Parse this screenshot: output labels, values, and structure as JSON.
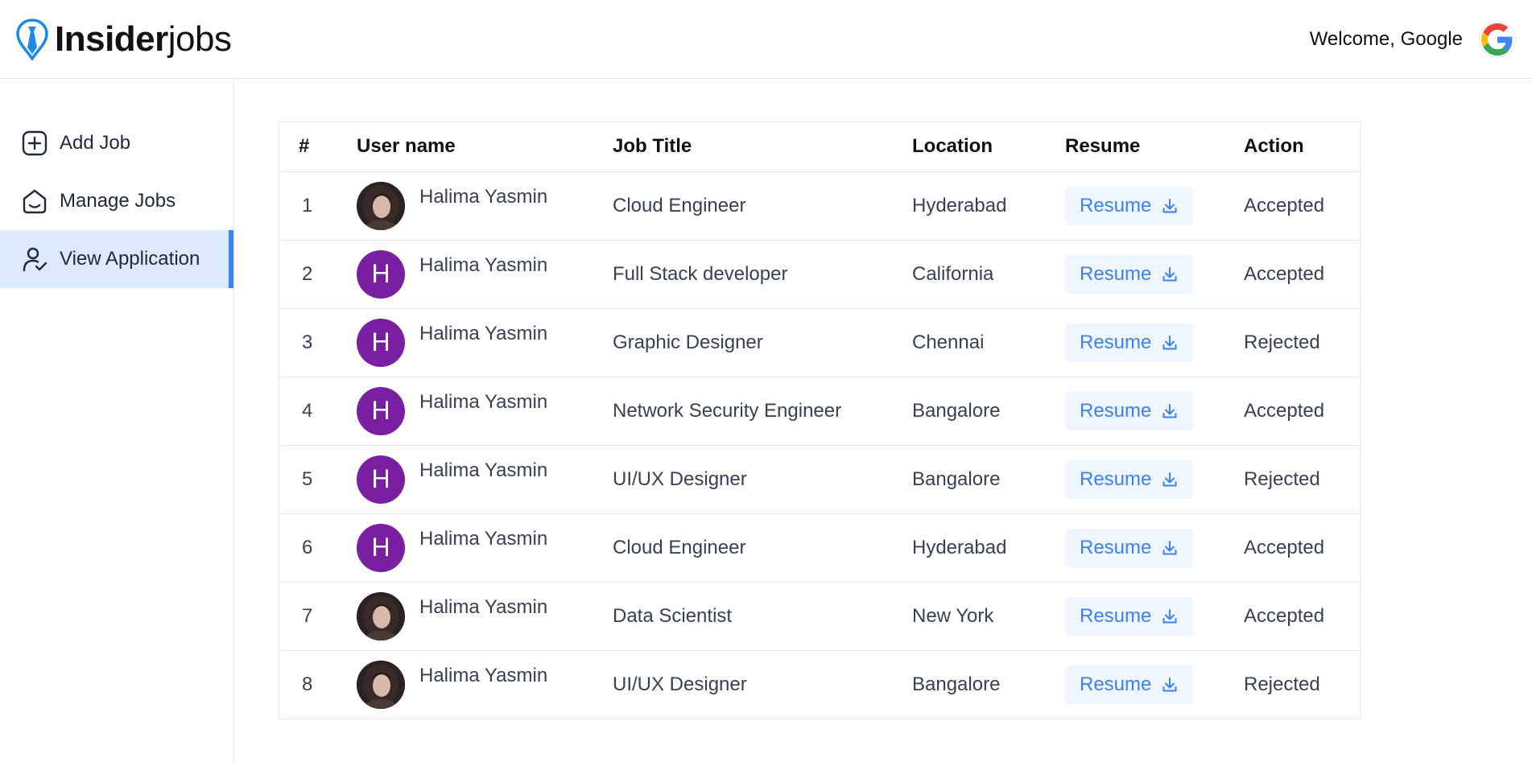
{
  "header": {
    "logo_bold": "Insider",
    "logo_light": "jobs",
    "welcome": "Welcome, Google",
    "avatar_icon": "google-icon"
  },
  "sidebar": {
    "items": [
      {
        "label": "Add Job",
        "icon": "add-square-icon",
        "active": false
      },
      {
        "label": "Manage Jobs",
        "icon": "home-icon",
        "active": false
      },
      {
        "label": "View Application",
        "icon": "person-check-icon",
        "active": true
      }
    ]
  },
  "table": {
    "columns": [
      "#",
      "User name",
      "Job Title",
      "Location",
      "Resume",
      "Action"
    ],
    "rows": [
      {
        "num": "1",
        "name": "Halima Yasmin",
        "avatar": "photo",
        "job": "Cloud Engineer",
        "location": "Hyderabad",
        "resume": "Resume",
        "action": "Accepted"
      },
      {
        "num": "2",
        "name": "Halima Yasmin",
        "avatar": "H",
        "job": "Full Stack developer",
        "location": "California",
        "resume": "Resume",
        "action": "Accepted"
      },
      {
        "num": "3",
        "name": "Halima Yasmin",
        "avatar": "H",
        "job": "Graphic Designer",
        "location": "Chennai",
        "resume": "Resume",
        "action": "Rejected"
      },
      {
        "num": "4",
        "name": "Halima Yasmin",
        "avatar": "H",
        "job": "Network Security Engineer",
        "location": "Bangalore",
        "resume": "Resume",
        "action": "Accepted"
      },
      {
        "num": "5",
        "name": "Halima Yasmin",
        "avatar": "H",
        "job": "UI/UX Designer",
        "location": "Bangalore",
        "resume": "Resume",
        "action": "Rejected"
      },
      {
        "num": "6",
        "name": "Halima Yasmin",
        "avatar": "H",
        "job": "Cloud Engineer",
        "location": "Hyderabad",
        "resume": "Resume",
        "action": "Accepted"
      },
      {
        "num": "7",
        "name": "Halima Yasmin",
        "avatar": "photo",
        "job": "Data Scientist",
        "location": "New York",
        "resume": "Resume",
        "action": "Accepted"
      },
      {
        "num": "8",
        "name": "Halima Yasmin",
        "avatar": "photo",
        "job": "UI/UX Designer",
        "location": "Bangalore",
        "resume": "Resume",
        "action": "Rejected"
      }
    ]
  },
  "colors": {
    "accent": "#3b82f6",
    "active_bg": "#dbeafe",
    "resume_bg": "#eff6ff",
    "avatar_letter_bg": "#7b1fa2"
  }
}
